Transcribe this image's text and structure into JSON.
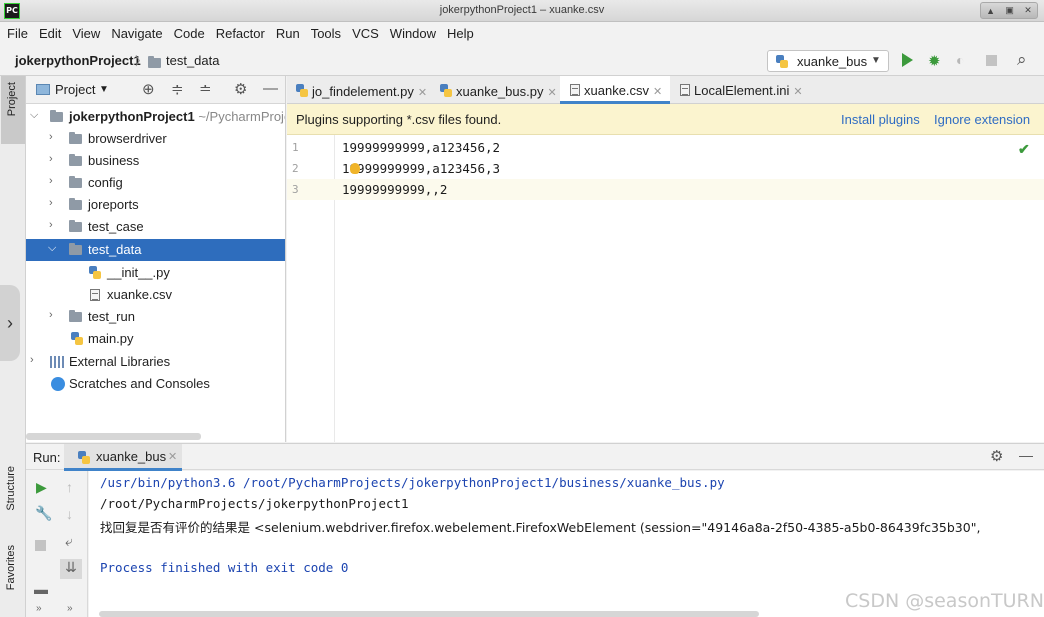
{
  "window": {
    "title": "jokerpythonProject1 – xuanke.csv",
    "app_icon": "PC"
  },
  "menu": [
    "File",
    "Edit",
    "View",
    "Navigate",
    "Code",
    "Refactor",
    "Run",
    "Tools",
    "VCS",
    "Window",
    "Help"
  ],
  "breadcrumb": {
    "project": "jokerpythonProject1",
    "folder": "test_data"
  },
  "run_config": {
    "name": "xuanke_bus"
  },
  "tool_strip": {
    "project": "Project",
    "structure": "Structure",
    "favorites": "Favorites"
  },
  "project_panel": {
    "title": "Project",
    "root": {
      "name": "jokerpythonProject1",
      "path": "~/PycharmProject"
    },
    "items": [
      {
        "name": "browserdriver"
      },
      {
        "name": "business"
      },
      {
        "name": "config"
      },
      {
        "name": "joreports"
      },
      {
        "name": "test_case"
      },
      {
        "name": "test_data"
      },
      {
        "name": "__init__.py"
      },
      {
        "name": "xuanke.csv"
      },
      {
        "name": "test_run"
      },
      {
        "name": "main.py"
      },
      {
        "name": "External Libraries"
      },
      {
        "name": "Scratches and Consoles"
      }
    ]
  },
  "tabs": [
    {
      "label": "jo_findelement.py"
    },
    {
      "label": "xuanke_bus.py"
    },
    {
      "label": "xuanke.csv"
    },
    {
      "label": "LocalElement.ini"
    }
  ],
  "banner": {
    "message": "Plugins supporting *.csv files found.",
    "install": "Install plugins",
    "ignore": "Ignore extension"
  },
  "editor": {
    "line_numbers": [
      "1",
      "2",
      "3"
    ],
    "lines": [
      "19999999999,a123456,2",
      "19999999999,a123456,3",
      "19999999999,,2"
    ]
  },
  "run": {
    "label": "Run:",
    "tab": "xuanke_bus",
    "output": [
      "/usr/bin/python3.6 /root/PycharmProjects/jokerpythonProject1/business/xuanke_bus.py",
      "/root/PycharmProjects/jokerpythonProject1",
      "找回复是否有评价的结果是 <selenium.webdriver.firefox.webelement.FirefoxWebElement (session=\"49146a8a-2f50-4385-a5b0-86439fc35b30\",",
      "Process finished with exit code 0"
    ]
  },
  "watermark": "CSDN @seasonTURN",
  "colors": {
    "selection": "#2e6dbd",
    "banner": "#fbf4cf",
    "console_blue": "#1c44b0",
    "run_green": "#3c9a3c",
    "link": "#2f6cc3"
  }
}
